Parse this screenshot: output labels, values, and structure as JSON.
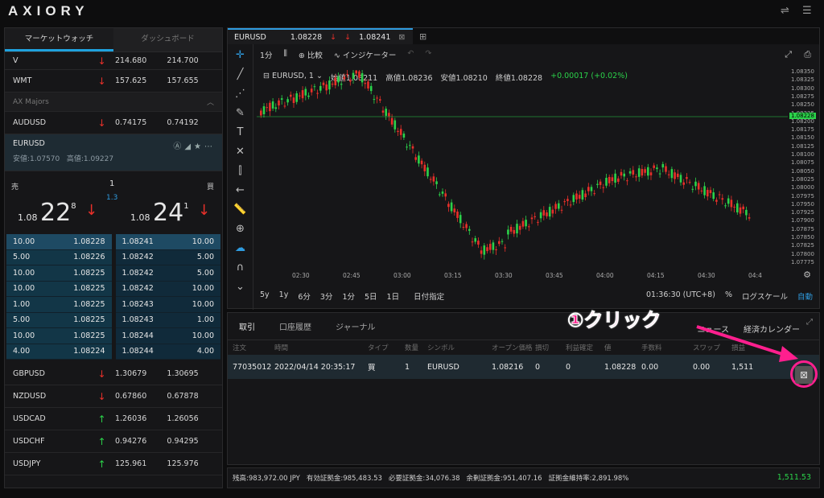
{
  "app": {
    "logo": "AXIORY"
  },
  "left": {
    "tabs": [
      "マーケットウォッチ",
      "ダッシュボード"
    ],
    "rows_top": [
      {
        "symbol": "V",
        "dir": "down",
        "bid": "214.680",
        "ask": "214.700"
      },
      {
        "symbol": "WMT",
        "dir": "down",
        "bid": "157.625",
        "ask": "157.655"
      }
    ],
    "group": "AX Majors",
    "audusd": {
      "symbol": "AUDUSD",
      "dir": "down",
      "bid": "0.74175",
      "ask": "0.74192"
    },
    "eurusd": {
      "symbol": "EURUSD",
      "low_label": "安値:1.07570",
      "high_label": "高値:1.09227",
      "sell_label": "売",
      "buy_label": "買",
      "spread": "1",
      "spread_sub": "1.3",
      "sell_prefix": "1.08",
      "sell_big": "22",
      "sell_sup": "8",
      "buy_prefix": "1.08",
      "buy_big": "24",
      "buy_sup": "1"
    },
    "depth_bid": [
      [
        "10.00",
        "1.08228"
      ],
      [
        "5.00",
        "1.08226"
      ],
      [
        "10.00",
        "1.08225"
      ],
      [
        "10.00",
        "1.08225"
      ],
      [
        "1.00",
        "1.08225"
      ],
      [
        "5.00",
        "1.08225"
      ],
      [
        "10.00",
        "1.08225"
      ],
      [
        "4.00",
        "1.08224"
      ]
    ],
    "depth_ask": [
      [
        "1.08241",
        "10.00"
      ],
      [
        "1.08242",
        "5.00"
      ],
      [
        "1.08242",
        "5.00"
      ],
      [
        "1.08242",
        "10.00"
      ],
      [
        "1.08243",
        "10.00"
      ],
      [
        "1.08243",
        "1.00"
      ],
      [
        "1.08244",
        "10.00"
      ],
      [
        "1.08244",
        "4.00"
      ]
    ],
    "rows_bottom": [
      {
        "symbol": "GBPUSD",
        "dir": "down",
        "bid": "1.30679",
        "ask": "1.30695"
      },
      {
        "symbol": "NZDUSD",
        "dir": "down",
        "bid": "0.67860",
        "ask": "0.67878"
      },
      {
        "symbol": "USDCAD",
        "dir": "up",
        "bid": "1.26036",
        "ask": "1.26056"
      },
      {
        "symbol": "USDCHF",
        "dir": "up",
        "bid": "0.94276",
        "ask": "0.94295"
      },
      {
        "symbol": "USDJPY",
        "dir": "up",
        "bid": "125.961",
        "ask": "125.976"
      }
    ]
  },
  "chart": {
    "tab_symbol": "EURUSD",
    "tab_bid": "1.08228",
    "tab_ask": "1.08241",
    "toolbar": {
      "interval": "1分",
      "compare": "比較",
      "indicators": "インジケーター"
    },
    "legend": {
      "symbol": "EURUSD, 1",
      "open": "始値1.08211",
      "high": "高値1.08236",
      "low": "安値1.08210",
      "close": "終値1.08228",
      "change": "+0.00017 (+0.02%)"
    },
    "time_labels": [
      "02:30",
      "02:45",
      "03:00",
      "03:15",
      "03:30",
      "03:45",
      "04:00",
      "04:15",
      "04:30",
      "04:4"
    ],
    "price_labels": [
      "1.08350",
      "1.08325",
      "1.08300",
      "1.08275",
      "1.08250",
      "1.08225",
      "1.08200",
      "1.08175",
      "1.08150",
      "1.08125",
      "1.08100",
      "1.08075",
      "1.08050",
      "1.08025",
      "1.08000",
      "1.07975",
      "1.07950",
      "1.07925",
      "1.07900",
      "1.07875",
      "1.07850",
      "1.07825",
      "1.07800",
      "1.07775"
    ],
    "current_price": "1.08228",
    "ranges": [
      "5y",
      "1y",
      "6分",
      "3分",
      "1分",
      "5日",
      "1日"
    ],
    "date_label": "日付指定",
    "clock": "01:36:30 (UTC+8)",
    "pct": "%",
    "log": "ログスケール",
    "auto": "自動"
  },
  "trade": {
    "tabs": [
      "取引",
      "口座履歴",
      "ジャーナル"
    ],
    "tabs_right": [
      "ニュース",
      "経済カレンダー"
    ],
    "headers": [
      "注文",
      "時間",
      "タイプ",
      "数量",
      "シンボル",
      "オープン価格",
      "損切",
      "利益確定",
      "値",
      "手数料",
      "スワップ",
      "損益"
    ],
    "row": {
      "id": "77035012",
      "time": "2022/04/14 20:35:17",
      "type": "買",
      "qty": "1",
      "symbol": "EURUSD",
      "open": "1.08216",
      "sl": "0",
      "tp": "0",
      "price": "1.08228",
      "fee": "0.00",
      "swap": "0.00",
      "pl": "1,511"
    }
  },
  "status": {
    "balance": "残高:983,972.00 JPY",
    "equity": "有効証拠金:985,483.53",
    "margin": "必要証拠金:34,076.38",
    "free": "余剰証拠金:951,407.16",
    "level": "証拠金維持率:2,891.98%",
    "profit": "1,511.53"
  },
  "annotation": "①クリック",
  "colors": {
    "up": "#2bd24a",
    "down": "#e8302a",
    "accent": "#1fa2de",
    "highlight": "#ff1f8e"
  }
}
